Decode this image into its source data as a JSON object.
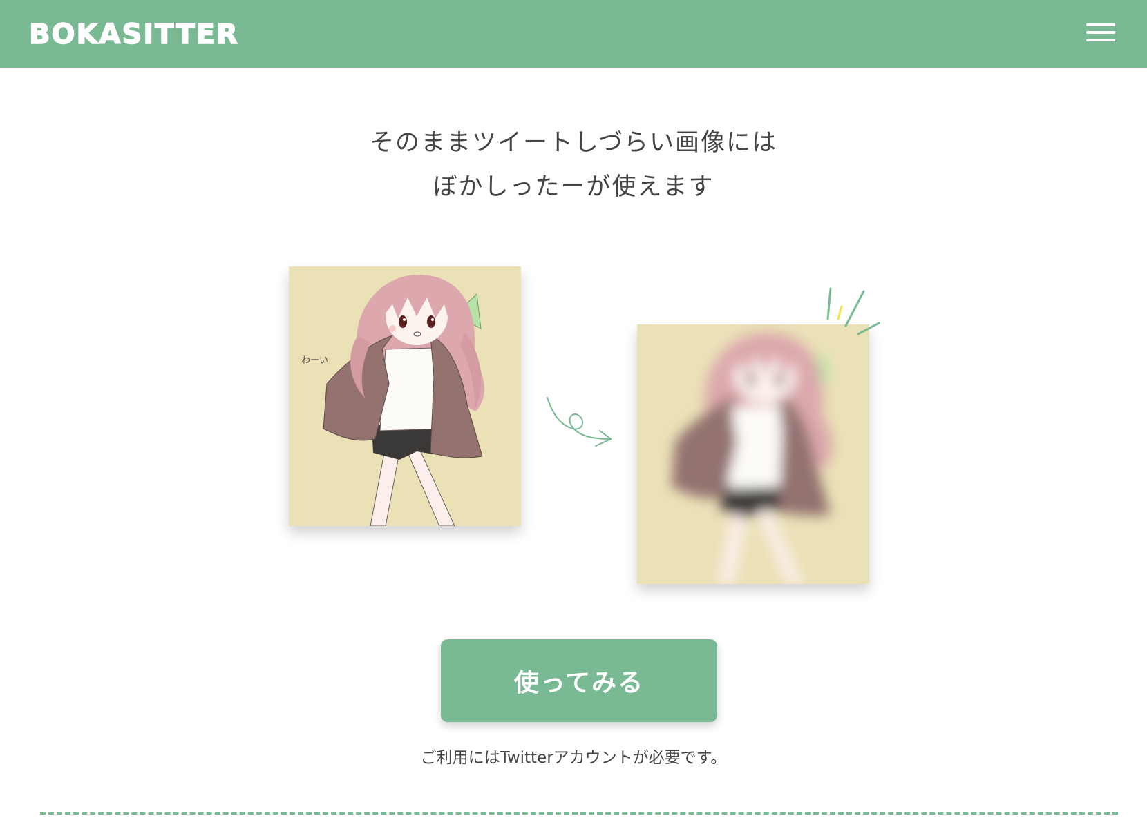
{
  "header": {
    "logo": "BOKASITTER",
    "menu_icon": "hamburger-menu-icon"
  },
  "hero": {
    "line1": "そのままツイートしづらい画像には",
    "line2": "ぼかしったーが使えます"
  },
  "illustration": {
    "doodle_text": "わーい",
    "arrow_icon": "curly-arrow-icon",
    "sparkle_icon": "sparkle-lines-icon"
  },
  "cta": {
    "label": "使ってみる"
  },
  "note": "ご利用にはTwitterアカウントが必要です。",
  "colors": {
    "brand": "#79b993",
    "card_background": "#ebe1b7",
    "hair": "#dca8ad",
    "cape": "#937270",
    "ribbon": "#b6e2a8",
    "accent_yellow": "#f2e64a"
  }
}
